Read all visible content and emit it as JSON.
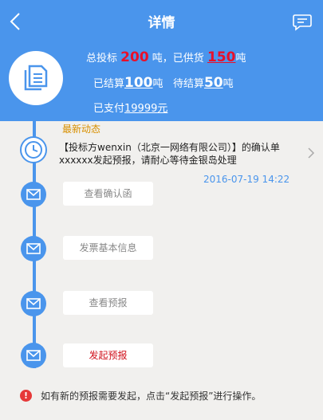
{
  "nav": {
    "title": "详情",
    "back_icon": "chevron-left-icon",
    "message_icon": "chat-icon"
  },
  "stats": {
    "total_bid_label": "总投标",
    "total_bid_value": "200",
    "unit_ton_1": "吨，已供货",
    "supplied_value": "150",
    "unit_ton_2": "吨",
    "settled_label": "已结算",
    "settled_value": "100",
    "unit_ton_3": "吨",
    "pending_label": "待结算",
    "pending_value": "50",
    "unit_ton_4": "吨",
    "paid_label": "已支付",
    "paid_value": "19999元"
  },
  "latest": {
    "label": "最新动态",
    "message": "【投标方wenxin（北京一网络有限公司）】的确认单xxxxxx发起预报，请耐心等待金银岛处理",
    "date": "2016-07-19  14:22"
  },
  "actions": [
    {
      "label": "查看确认函"
    },
    {
      "label": "发票基本信息"
    },
    {
      "label": "查看预报"
    },
    {
      "label": "发起预报"
    }
  ],
  "notice": {
    "icon": "!",
    "text": "如有新的预报需要发起，点击“发起预报”进行操作。"
  },
  "colors": {
    "primary": "#4a95ec",
    "highlight_red": "#e8102a",
    "latest_label": "#d89000",
    "action_red": "#d0101b"
  }
}
